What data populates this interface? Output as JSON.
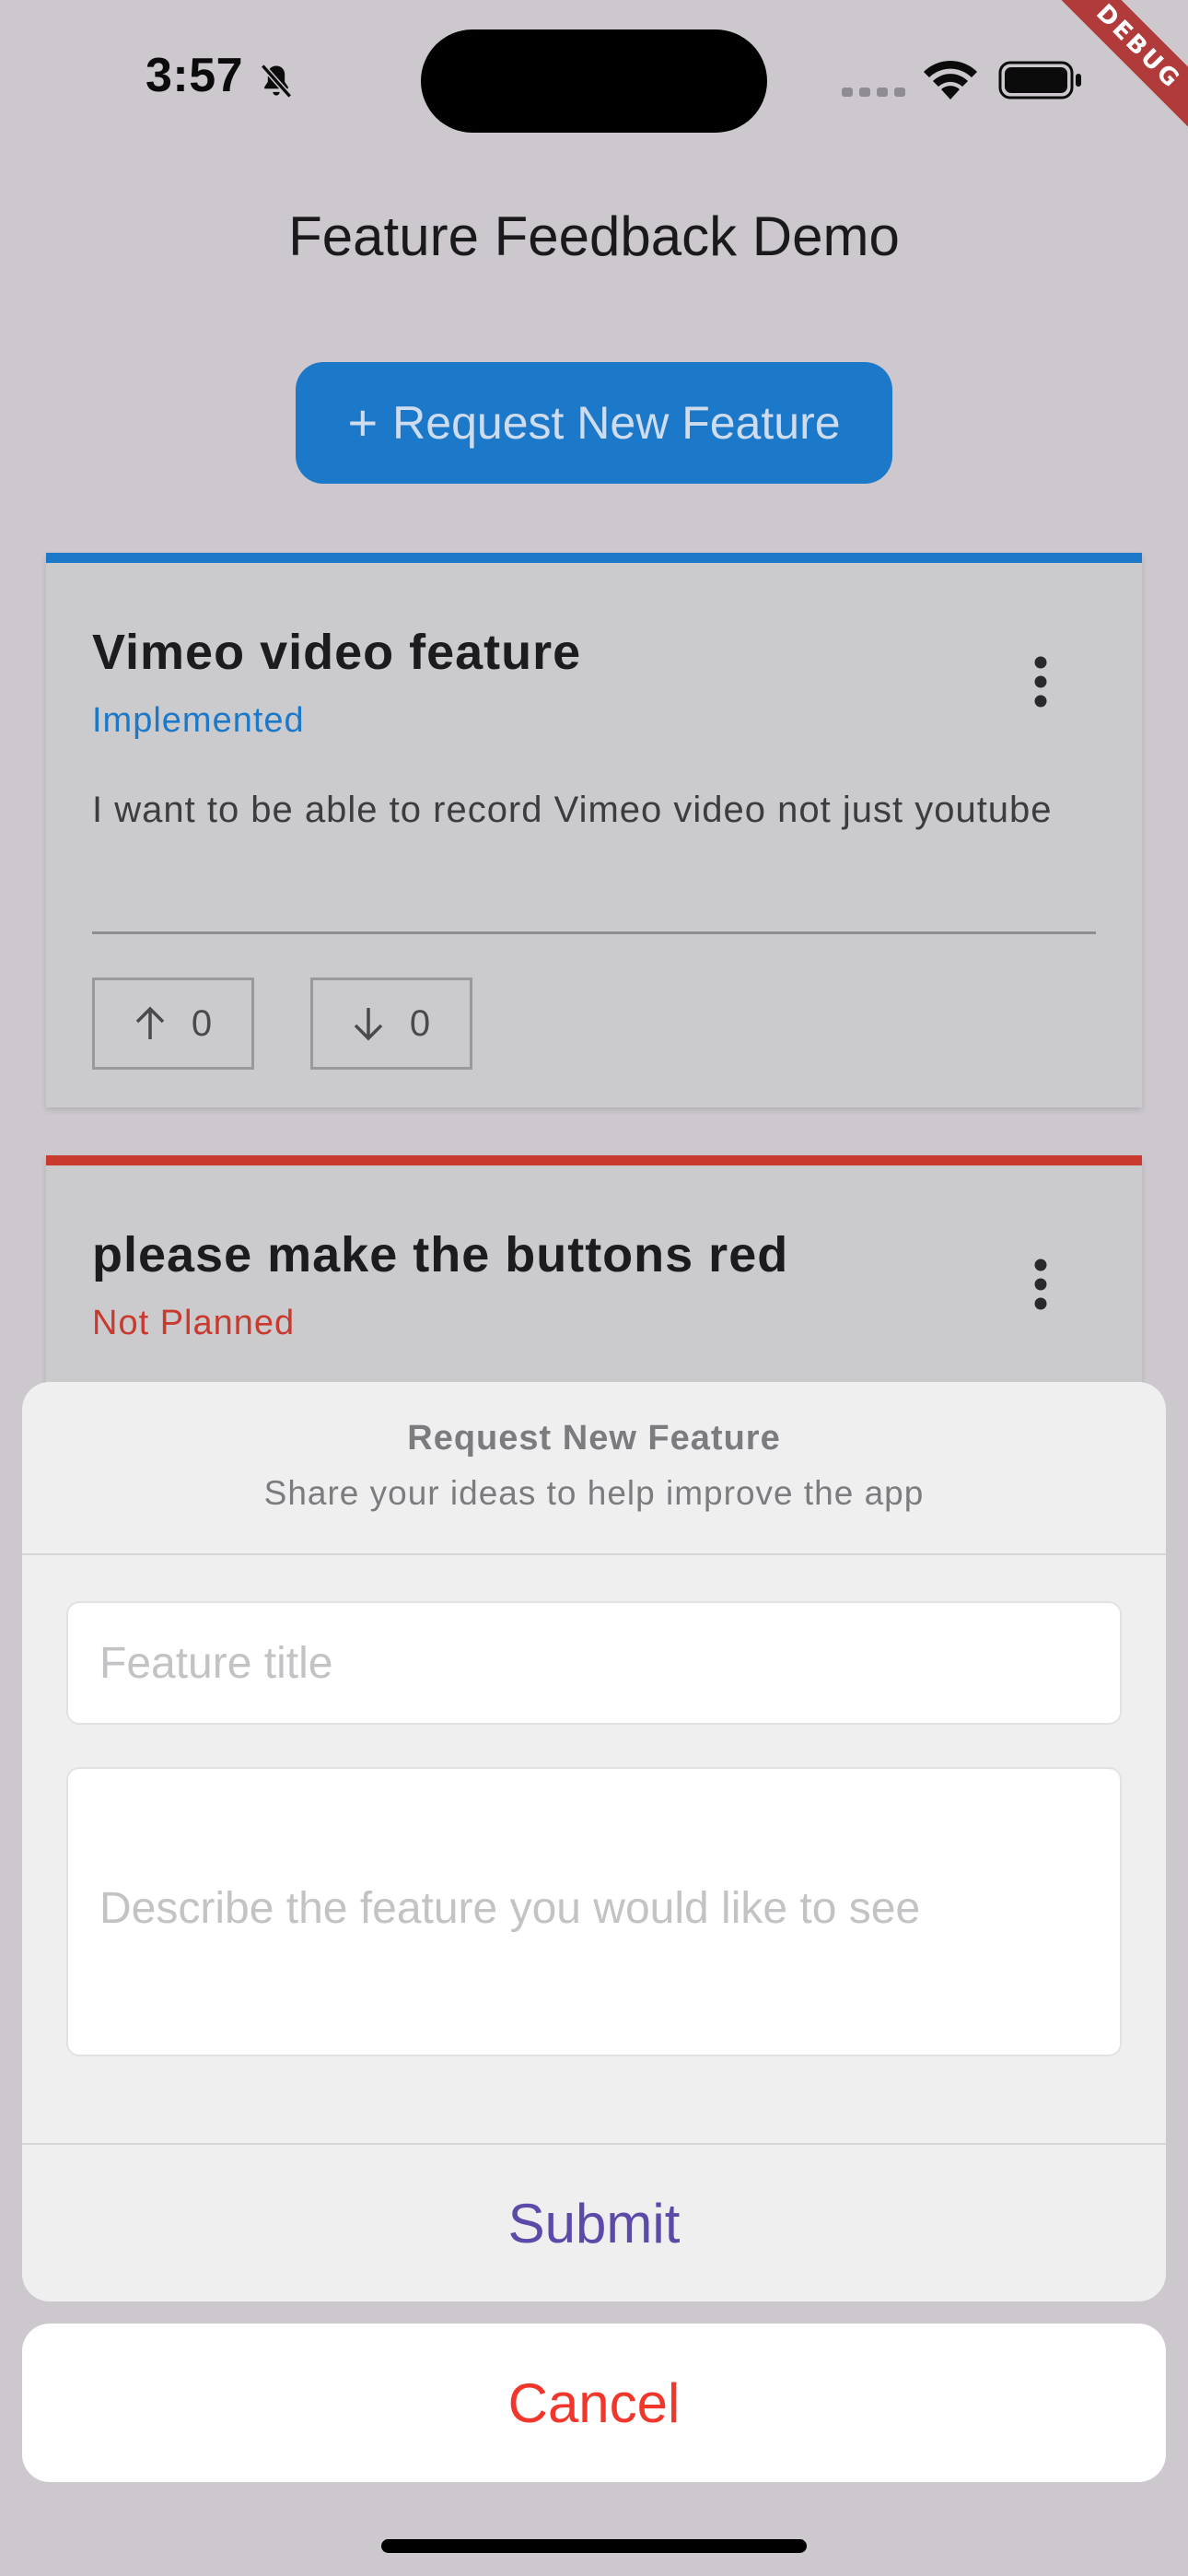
{
  "status_bar": {
    "time": "3:57",
    "icons": [
      "bell-off-icon",
      "signal-icon",
      "wifi-icon",
      "battery-icon"
    ]
  },
  "debug_banner": "DEBUG",
  "app_bar": {
    "title": "Feature Feedback Demo"
  },
  "request_button": {
    "icon": "plus-icon",
    "label": "Request New Feature"
  },
  "features": [
    {
      "title": "Vimeo video feature",
      "status": "Implemented",
      "status_color": "#1c78c9",
      "description": "I want to be able to record Vimeo video not just youtube",
      "upvotes": "0",
      "downvotes": "0"
    },
    {
      "title": "please make the buttons red",
      "status": "Not Planned",
      "status_color": "#c8392e"
    }
  ],
  "sheet": {
    "title": "Request New Feature",
    "subtitle": "Share your ideas to help improve the app",
    "title_placeholder": "Feature title",
    "description_placeholder": "Describe the feature you would like to see",
    "submit_label": "Submit",
    "cancel_label": "Cancel"
  },
  "colors": {
    "accent": "#1c78c9",
    "danger": "#c8392e",
    "submit": "#5d49a8",
    "cancel": "#f1372b"
  }
}
